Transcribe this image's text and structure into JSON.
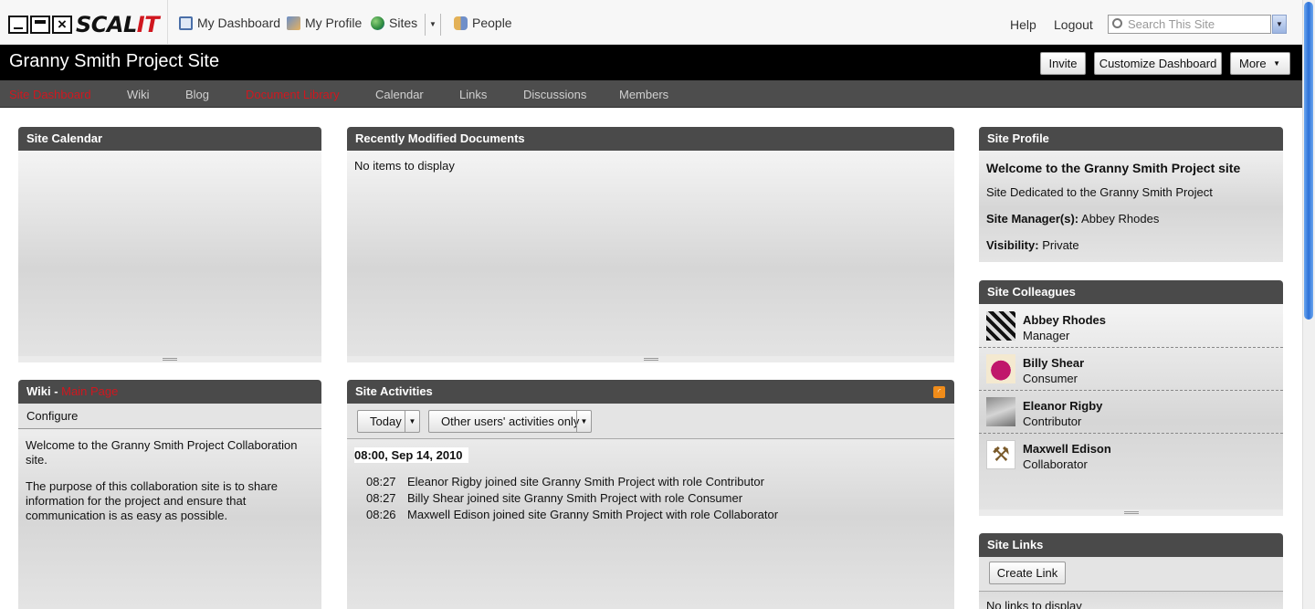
{
  "app": {
    "logo_main": "SCAL",
    "logo_accent": "IT",
    "topnav": {
      "dashboard": "My Dashboard",
      "profile": "My Profile",
      "sites": "Sites",
      "people": "People",
      "help": "Help",
      "logout": "Logout",
      "search_placeholder": "Search This Site"
    }
  },
  "site": {
    "title": "Granny Smith Project Site",
    "buttons": {
      "invite": "Invite",
      "customize": "Customize Dashboard",
      "more": "More"
    },
    "tabs": [
      "Site Dashboard",
      "Wiki",
      "Blog",
      "Document Library",
      "Calendar",
      "Links",
      "Discussions",
      "Members"
    ]
  },
  "dashlets": {
    "calendar": {
      "title": "Site Calendar"
    },
    "recent_docs": {
      "title": "Recently Modified Documents",
      "empty": "No items to display"
    },
    "wiki": {
      "title": "Wiki - ",
      "page_link": "Main Page",
      "configure": "Configure",
      "para1": "Welcome to the Granny Smith Project Collaboration site.",
      "para2": "The purpose of this collaboration site is to share information for the project and ensure that communication is as easy as possible."
    },
    "activities": {
      "title": "Site Activities",
      "filter_range": "Today",
      "filter_users": "Other users' activities only",
      "date_heading": "08:00, Sep 14, 2010",
      "items": [
        {
          "time": "08:27",
          "text": "Eleanor Rigby joined site Granny Smith Project with role Contributor"
        },
        {
          "time": "08:27",
          "text": "Billy Shear joined site Granny Smith Project with role Consumer"
        },
        {
          "time": "08:26",
          "text": "Maxwell Edison joined site Granny Smith Project with role Collaborator"
        }
      ]
    },
    "profile": {
      "title": "Site Profile",
      "welcome": "Welcome to the Granny Smith Project site",
      "description": "Site Dedicated to the Granny Smith Project",
      "manager_label": "Site Manager(s):",
      "manager_value": "Abbey Rhodes",
      "visibility_label": "Visibility:",
      "visibility_value": "Private"
    },
    "colleagues": {
      "title": "Site Colleagues",
      "people": [
        {
          "name": "Abbey Rhodes",
          "role": "Manager"
        },
        {
          "name": "Billy Shear",
          "role": "Consumer"
        },
        {
          "name": "Eleanor Rigby",
          "role": "Contributor"
        },
        {
          "name": "Maxwell Edison",
          "role": "Collaborator"
        }
      ]
    },
    "links": {
      "title": "Site Links",
      "create": "Create Link",
      "empty": "No links to display"
    }
  }
}
